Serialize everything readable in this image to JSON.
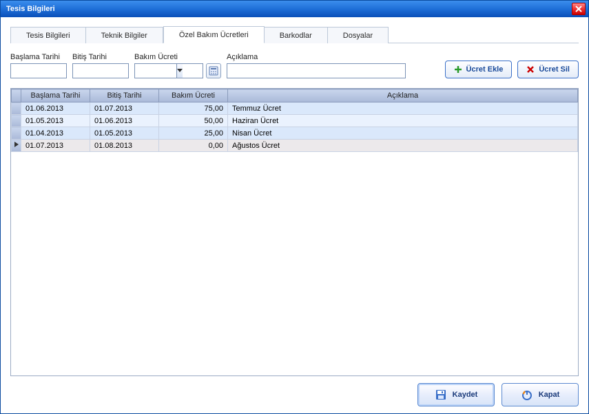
{
  "window": {
    "title": "Tesis Bilgileri"
  },
  "tabs": [
    {
      "label": "Tesis Bilgileri"
    },
    {
      "label": "Teknik Bilgiler"
    },
    {
      "label": "Özel Bakım Ücretleri"
    },
    {
      "label": "Barkodlar"
    },
    {
      "label": "Dosyalar"
    }
  ],
  "form": {
    "baslama_label": "Başlama Tarihi",
    "bitis_label": "Bitiş Tarihi",
    "bakim_label": "Bakım Ücreti",
    "aciklama_label": "Açıklama",
    "baslama_value": "",
    "bitis_value": "",
    "bakim_value": "",
    "aciklama_value": ""
  },
  "buttons": {
    "ucret_ekle": "Ücret Ekle",
    "ucret_sil": "Ücret Sil",
    "kaydet": "Kaydet",
    "kapat": "Kapat"
  },
  "grid": {
    "headers": {
      "baslama": "Başlama Tarihi",
      "bitis": "Bitiş Tarihi",
      "bakim": "Bakım Ücreti",
      "aciklama": "Açıklama"
    },
    "rows": [
      {
        "baslama": "01.06.2013",
        "bitis": "01.07.2013",
        "bakim": "75,00",
        "aciklama": "Temmuz Ücret"
      },
      {
        "baslama": "01.05.2013",
        "bitis": "01.06.2013",
        "bakim": "50,00",
        "aciklama": "Haziran Ücret"
      },
      {
        "baslama": "01.04.2013",
        "bitis": "01.05.2013",
        "bakim": "25,00",
        "aciklama": "Nisan Ücret"
      },
      {
        "baslama": "01.07.2013",
        "bitis": "01.08.2013",
        "bakim": "0,00",
        "aciklama": "Ağustos Ücret"
      }
    ]
  }
}
